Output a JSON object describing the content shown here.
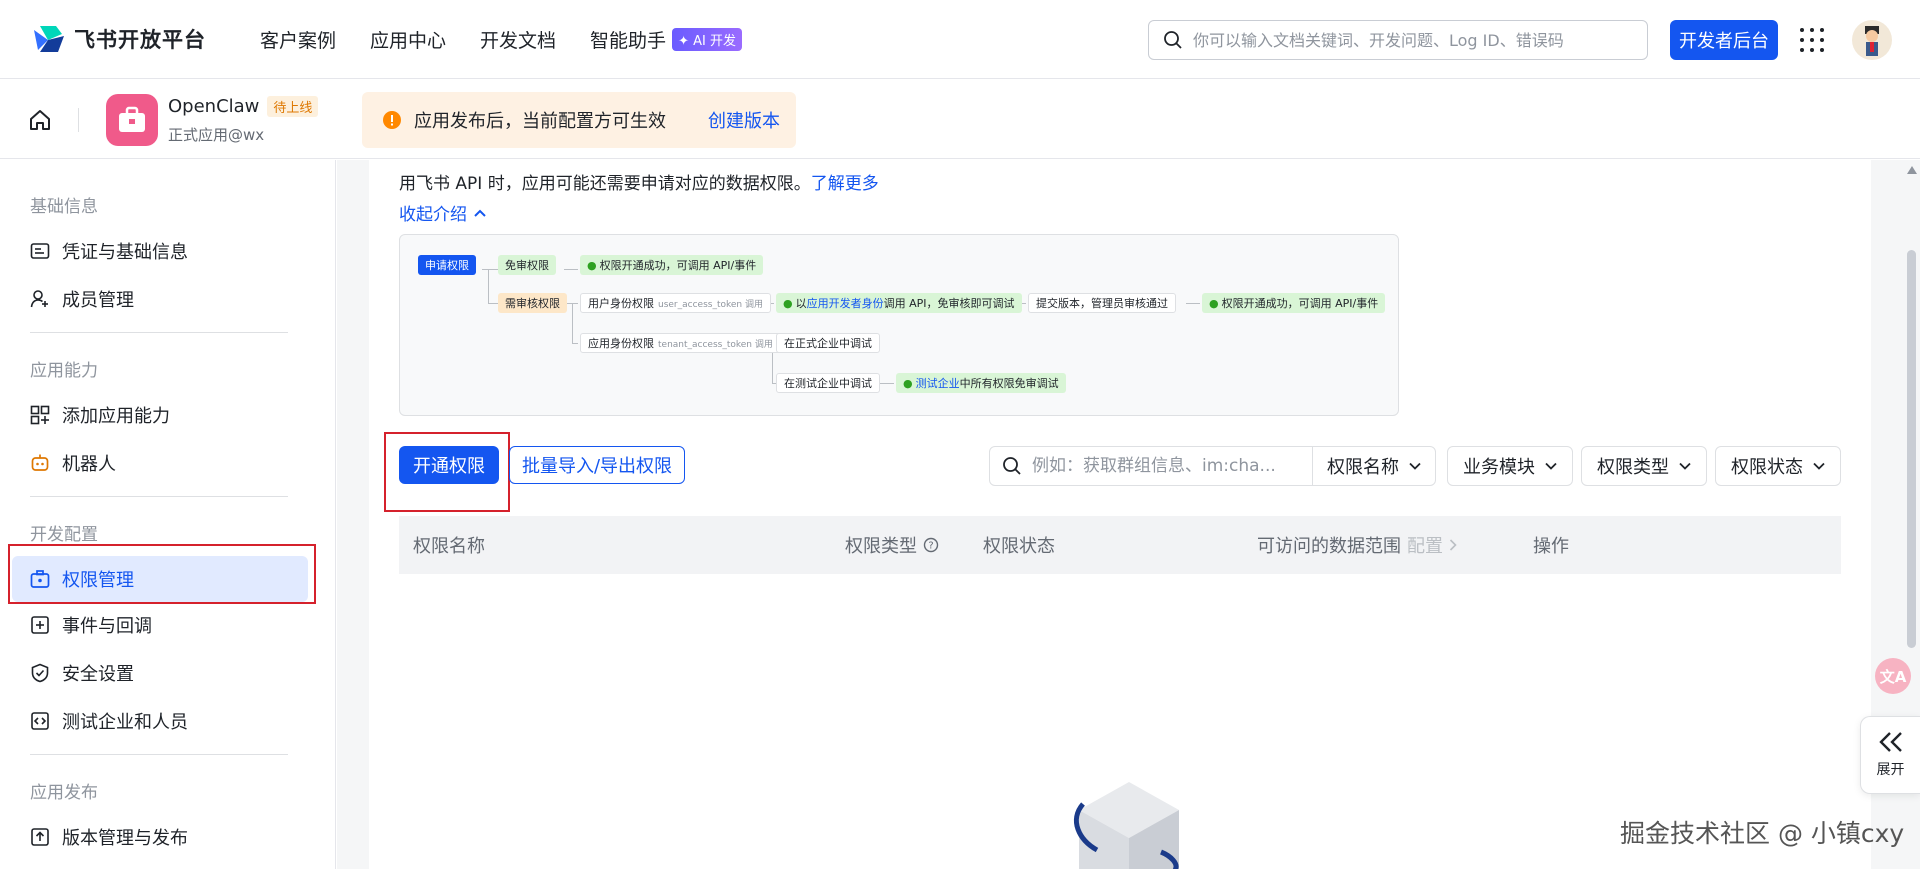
{
  "topnav": {
    "brand": "飞书开放平台",
    "items": [
      {
        "label": "客户案例"
      },
      {
        "label": "应用中心"
      },
      {
        "label": "开发文档"
      },
      {
        "label": "智能助手",
        "badge": "AI 开发"
      }
    ],
    "search_placeholder": "你可以输入文档关键词、开发问题、Log ID、错误码",
    "dev_console": "开发者后台"
  },
  "apphead": {
    "app_name": "OpenClaw",
    "status": "待上线",
    "sub": "正式应用@wx",
    "notice": "应用发布后，当前配置方可生效",
    "notice_link": "创建版本"
  },
  "sidebar": {
    "sections": [
      {
        "title": "基础信息",
        "items": [
          "凭证与基础信息",
          "成员管理"
        ]
      },
      {
        "title": "应用能力",
        "items": [
          "添加应用能力",
          "机器人"
        ]
      },
      {
        "title": "开发配置",
        "items": [
          "权限管理",
          "事件与回调",
          "安全设置",
          "测试企业和人员"
        ]
      },
      {
        "title": "应用发布",
        "items": [
          "版本管理与发布"
        ]
      }
    ],
    "active": "权限管理"
  },
  "main": {
    "intro_line2": "用飞书 API 时，应用可能还需要申请对应的数据权限。",
    "learn_more": "了解更多",
    "collapse": "收起介绍",
    "flow": {
      "apply": "申请权限",
      "free": "免审权限",
      "success": "权限开通成功，可调用 API/事件",
      "need_review": "需审核权限",
      "user_perm": "用户身份权限",
      "user_token": "user_access_token 调用",
      "dev_prefix": "以",
      "dev_link": "应用开发者身份",
      "dev_suffix": "调用 API，免审核即可调试",
      "submit": "提交版本，管理员审核通过",
      "success2": "权限开通成功，可调用 API/事件",
      "app_perm": "应用身份权限",
      "app_token": "tenant_access_token 调用",
      "prod_debug": "在正式企业中调试",
      "test_debug": "在测试企业中调试",
      "test_link": "测试企业",
      "test_suffix": "中所有权限免审调试"
    },
    "btn_enable": "开通权限",
    "btn_batch": "批量导入/导出权限",
    "filter_placeholder": "例如：获取群组信息、im:cha...",
    "filter_name": "权限名称",
    "filter_module": "业务模块",
    "filter_type": "权限类型",
    "filter_status": "权限状态",
    "table_headers": {
      "name": "权限名称",
      "type": "权限类型",
      "status": "权限状态",
      "scope": "可访问的数据范围",
      "config": "配置",
      "action": "操作"
    }
  },
  "floating": {
    "expand": "展开",
    "watermark": "掘金技术社区 @ 小镇cxy"
  }
}
